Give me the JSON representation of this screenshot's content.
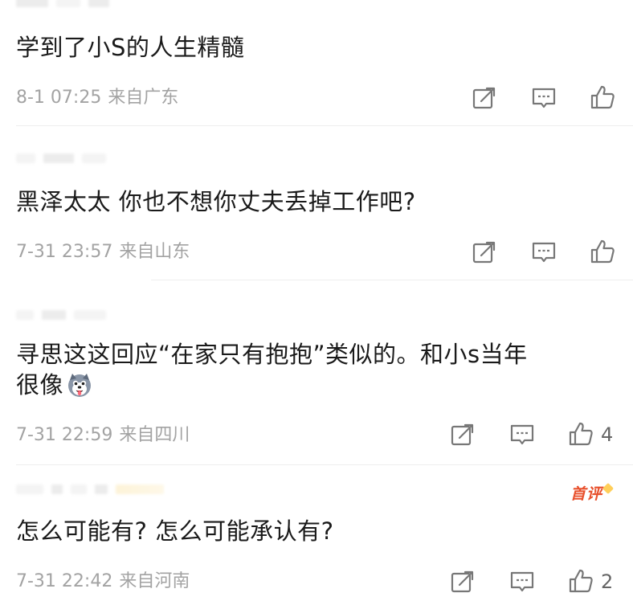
{
  "comments": [
    {
      "text": "学到了小S的人生精髓",
      "date": "8-1 07:25",
      "location": "来自广东",
      "likes": ""
    },
    {
      "text": "黑泽太太 你也不想你丈夫丢掉工作吧?",
      "date": "7-31 23:57",
      "location": "来自山东",
      "likes": ""
    },
    {
      "text": "寻思这这回应“在家只有抱抱”类似的。和小s当年",
      "text_line2": "很像",
      "emoji": "husky-dog-emoji",
      "date": "7-31 22:59",
      "location": "来自四川",
      "likes": "4"
    },
    {
      "badge": "首评",
      "text": "怎么可能有? 怎么可能承认有?",
      "date": "7-31 22:42",
      "location": "来自河南",
      "likes": "2"
    }
  ],
  "icons": {
    "repost": "repost-icon",
    "comment": "comment-icon",
    "like": "thumbs-up-icon"
  },
  "colors": {
    "text": "#1a1a1a",
    "meta": "#a3a3a3",
    "icon": "#777777",
    "badge": "#e8502c"
  }
}
